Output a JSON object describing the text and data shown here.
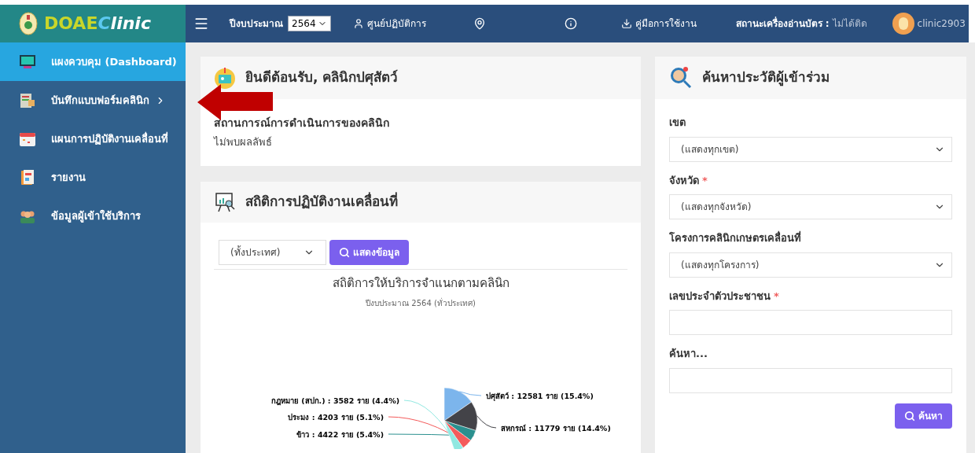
{
  "logo": {
    "text_a": "DOAE",
    "text_b": "Clinic"
  },
  "header": {
    "year_label": "ปีงบประมาณ",
    "year_value": "2564",
    "center": "ศูนย์ปฏิบัติการ",
    "manual": "คู่มือการใช้งาน",
    "reader_label": "สถานะเครื่องอ่านบัตร :",
    "reader_status": "ไม่ได้ติด",
    "user": "clinic2903"
  },
  "sidebar": {
    "items": [
      {
        "label": "แผงควบคุม (Dashboard)",
        "selected": true,
        "has_submenu": false
      },
      {
        "label": "บันทึกแบบฟอร์มคลินิก",
        "selected": false,
        "has_submenu": true
      },
      {
        "label": "แผนการปฏิบัติงานเคลื่อนที่",
        "selected": false,
        "has_submenu": false
      },
      {
        "label": "รายงาน",
        "selected": false,
        "has_submenu": false
      },
      {
        "label": "ข้อมูลผู้เข้าใช้บริการ",
        "selected": false,
        "has_submenu": false
      }
    ]
  },
  "welcome": {
    "title": "ยินดีต้อนรับ, คลินิกปศุสัตว์",
    "heading": "สถานการณ์การดำเนินการของคลินิก",
    "message": "ไม่พบผลลัพธ์"
  },
  "stats": {
    "title": "สถิติการปฏิบัติงานเคลื่อนที่",
    "region_select": "(ทั้งประเทศ)",
    "show_button": "แสดงข้อมูล",
    "chart_data": {
      "type": "pie",
      "title": "สถิติการให้บริการจำแนกตามคลินิก",
      "subtitle": "ปีงบประมาณ 2564 (ทั่วประเทศ)",
      "categories": [
        "ปศุสัตว์ : 12581 ราย (15.4%)",
        "สหกรณ์ : 11779 ราย (14.4%)",
        "ข้าว : 4422 ราย (5.4%)",
        "ประมง : 4203 ราย (5.1%)",
        "กฎหมาย (สปก.) : 3582 ราย (4.4%)"
      ],
      "series": [
        {
          "values": [
            15.4,
            14.4,
            5.4,
            5.1,
            4.4
          ],
          "colors": [
            "#7cb5ec",
            "#434348",
            "#2b908f",
            "#f45b5b",
            "#91e8e1"
          ]
        }
      ]
    }
  },
  "search": {
    "title": "ค้นหาประวัติผู้เข้าร่วม",
    "fields": [
      {
        "kind": "select",
        "label": "เขต",
        "required": false,
        "value": "(แสดงทุกเขต)"
      },
      {
        "kind": "select",
        "label": "จังหวัด",
        "required": true,
        "value": "(แสดงทุกจังหวัด)"
      },
      {
        "kind": "select",
        "label": "โครงการคลินิกเกษตรเคลื่อนที่",
        "required": false,
        "value": "(แสดงทุกโครงการ)"
      },
      {
        "kind": "input",
        "label": "เลขประจำตัวประชาชน",
        "required": true
      },
      {
        "kind": "input",
        "label": "ค้นหา...",
        "required": false
      }
    ],
    "required_mark": "*",
    "button": "ค้นหา"
  }
}
